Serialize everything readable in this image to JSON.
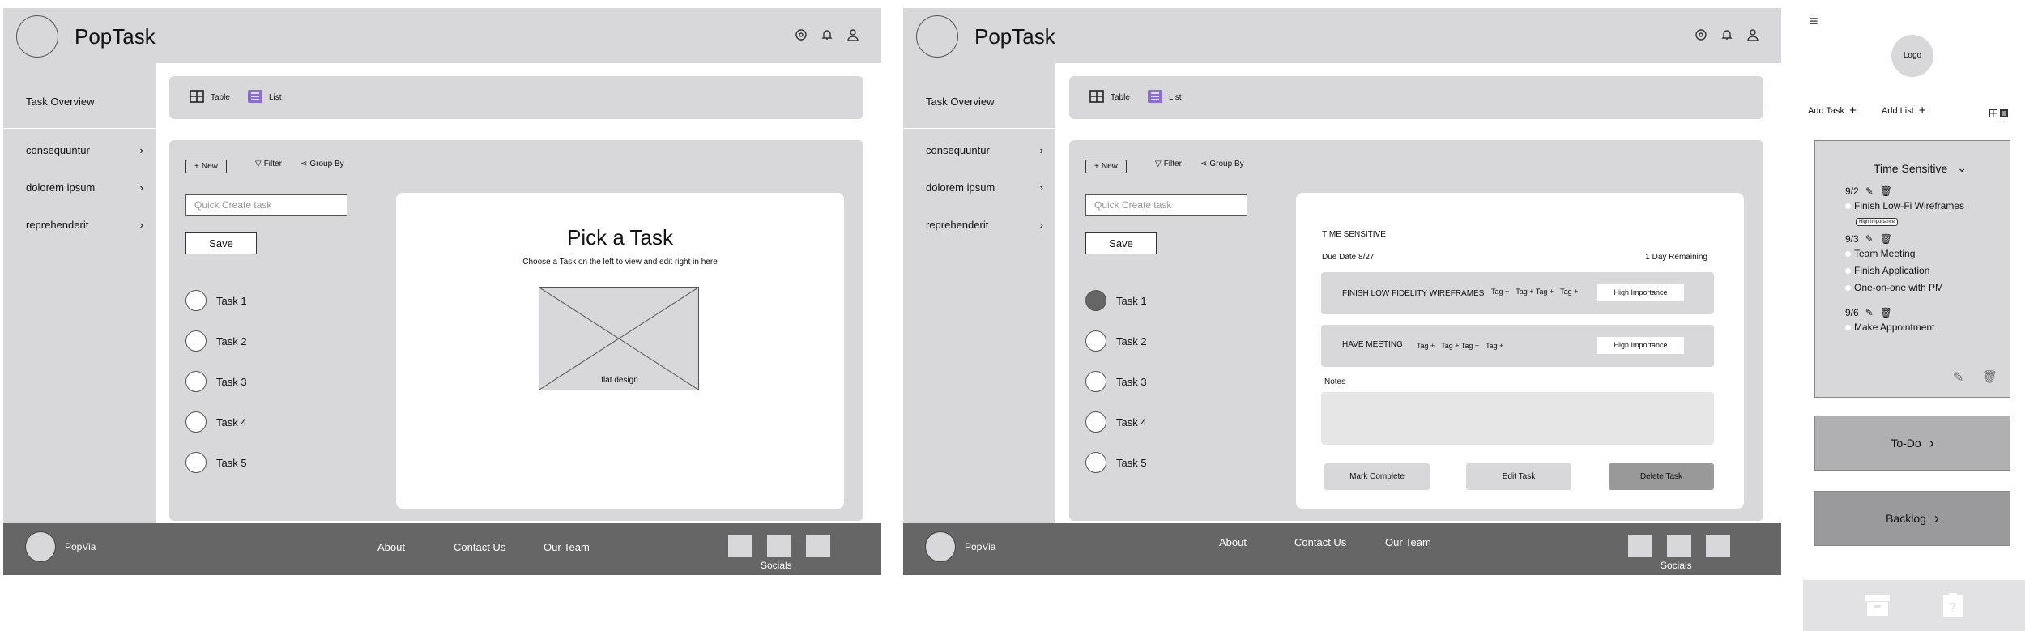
{
  "app": {
    "title": "PopTask"
  },
  "sidebar": {
    "heading": "Task Overview",
    "items": [
      {
        "label": "consequuntur"
      },
      {
        "label": "dolorem ipsum"
      },
      {
        "label": "reprehenderit"
      }
    ]
  },
  "views": {
    "table_label": "Table",
    "list_label": "List"
  },
  "toolbar": {
    "new_label": "New",
    "filter_label": "Filter",
    "group_label": "Group By"
  },
  "quick_create": {
    "placeholder": "Quick Create task",
    "save_label": "Save"
  },
  "tasks": [
    "Task 1",
    "Task 2",
    "Task 3",
    "Task 4",
    "Task 5"
  ],
  "empty_state": {
    "title": "Pick a Task",
    "subtitle": "Choose a Task on the left to view and edit right in here",
    "image_label": "flat design"
  },
  "footer": {
    "brand": "PopVia",
    "links": [
      "About",
      "Contact Us",
      "Our Team"
    ],
    "socials_label": "Socials"
  },
  "detail": {
    "category": "TIME SENSITIVE",
    "due": "Due Date 8/27",
    "remaining": "1 Day Remaining",
    "rows": [
      {
        "name": "FINISH LOW FIDELITY WIREFRAMES",
        "tags": [
          "Tag +",
          "Tag + Tag +",
          "Tag +"
        ],
        "importance": "High Importance"
      },
      {
        "name": "HAVE MEETING",
        "tags": [
          "Tag +",
          "Tag + Tag +",
          "Tag +"
        ],
        "importance": "High Importance"
      }
    ],
    "notes_label": "Notes",
    "buttons": {
      "complete": "Mark Complete",
      "edit": "Edit Task",
      "delete": "Delete Task"
    }
  },
  "mobile": {
    "logo": "Logo",
    "add_task": "Add Task",
    "add_list": "Add List",
    "card_title": "Time Sensitive",
    "groups": [
      {
        "date": "9/2",
        "items": [
          "Finish Low-Fi Wireframes"
        ],
        "chip": "High Importance"
      },
      {
        "date": "9/3",
        "items": [
          "Team Meeting",
          "Finish Application",
          "One-on-one with PM"
        ]
      },
      {
        "date": "9/6",
        "items": [
          "Make Appointment"
        ]
      }
    ],
    "todo_label": "To-Do",
    "backlog_label": "Backlog"
  },
  "colors": {
    "frame": "#d8d8da",
    "footer": "#666666",
    "accent": "#8a6fd0",
    "delete_btn": "#999999"
  }
}
